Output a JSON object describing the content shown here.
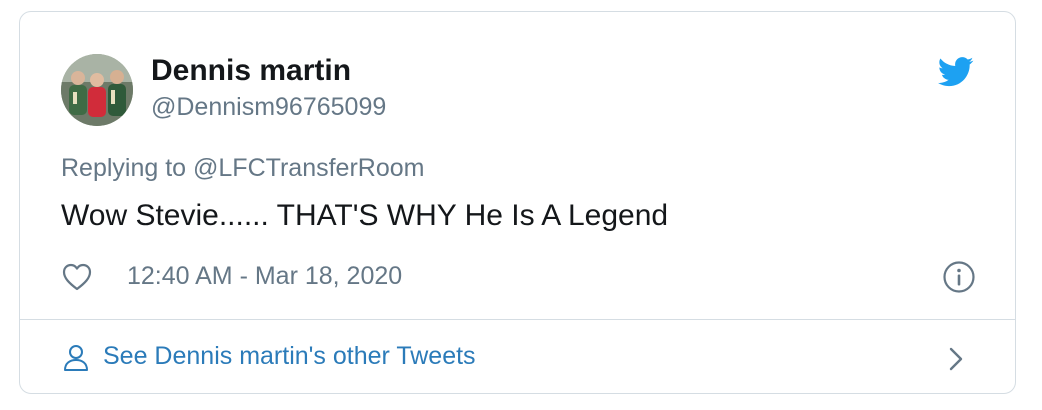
{
  "author": {
    "display_name": "Dennis martin",
    "handle": "@Dennism96765099",
    "avatar_icon": "profile-photo"
  },
  "reply": {
    "text": "Replying to @LFCTransferRoom"
  },
  "tweet": {
    "text": "Wow Stevie...... THAT'S WHY He Is A Legend",
    "timestamp": "12:40 AM - Mar 18, 2020"
  },
  "footer": {
    "link_label": "See Dennis martin's other Tweets"
  },
  "icons": {
    "brand": "twitter-bird-icon",
    "like": "heart-icon",
    "info": "info-icon",
    "person": "person-icon",
    "chevron": "chevron-right-icon"
  },
  "colors": {
    "brand_blue": "#1da1f2",
    "link_blue": "#2b7bb9",
    "text_primary": "#14171a",
    "text_secondary": "#657786",
    "border": "#d5dde3"
  }
}
